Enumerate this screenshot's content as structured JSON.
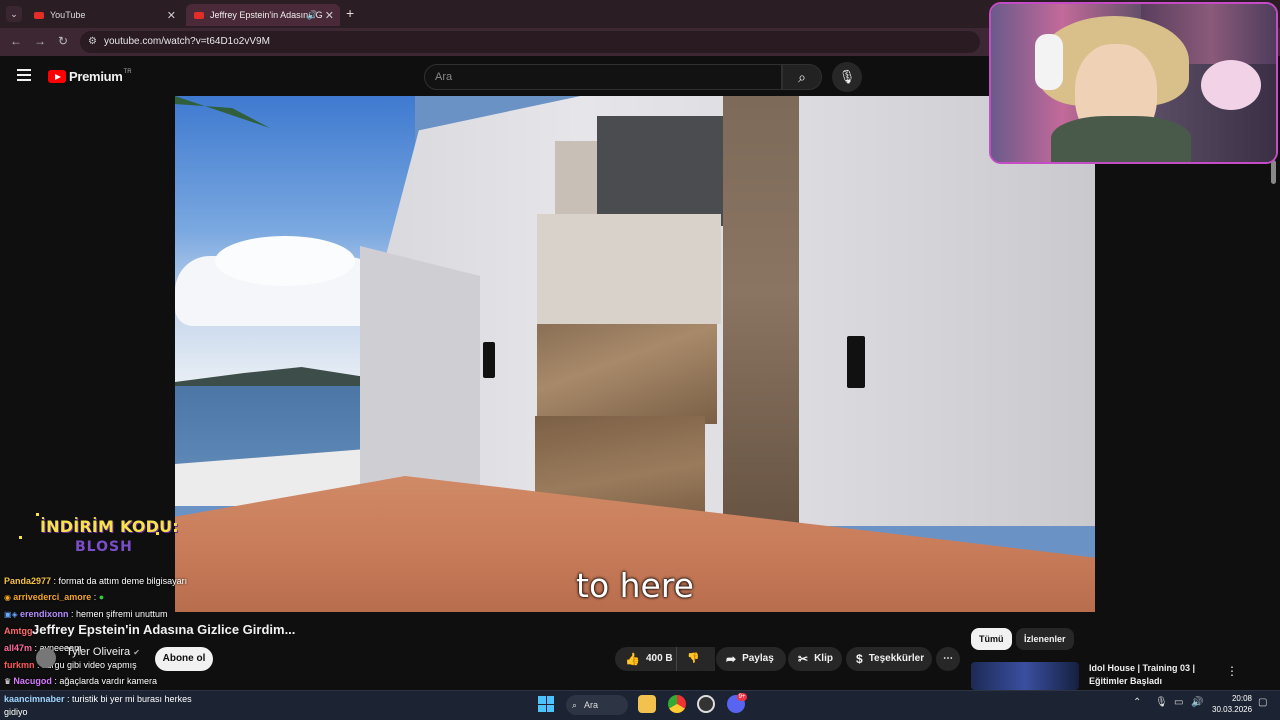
{
  "browser": {
    "tabs": [
      {
        "label": "YouTube"
      },
      {
        "label": "Jeffrey Epstein'in Adasına G"
      }
    ],
    "url": "youtube.com/watch?v=t64D1o2vV9M"
  },
  "youtube": {
    "logo_text": "Premium",
    "logo_region": "TR",
    "search_placeholder": "Ara"
  },
  "video": {
    "subtitle": "to here",
    "title": "Jeffrey Epstein'in Adasına Gizlice Girdim...",
    "channel": "Tyler Oliveira",
    "subscribe_label": "Abone ol",
    "likes": "400 B",
    "share_label": "Paylaş",
    "clip_label": "Klip",
    "thanks_label": "Teşekkürler"
  },
  "sidebar": {
    "chips": [
      "Tümü",
      "İzlenenler"
    ],
    "recommendation": {
      "title": "Idol House | Training 03 | Eğitimler Başladı"
    }
  },
  "overlay": {
    "promo_line1": "İNDİRİM KODU:",
    "promo_line2": "BLOSH",
    "chat": [
      {
        "user": "Panda2977",
        "text": " : format da attım deme bilgisayarı",
        "color": "#f7c24a"
      },
      {
        "user": "arrivederci_amore",
        "text": " : ",
        "color": "#f5a623"
      },
      {
        "user": "erendixonn",
        "text": " : hemen şifremi unuttum",
        "color": "#b48cff"
      },
      {
        "user": "Amtgg",
        "text": " : ",
        "color": "#ff6b6b"
      },
      {
        "user": "all47m",
        "text": " : ayneeeem",
        "color": "#ff6b9a"
      },
      {
        "user": "furkmn",
        "text": " : kurgu gibi video yapmış",
        "color": "#ff5a5a"
      },
      {
        "user": "Nacugod",
        "text": " : ağaçlarda vardır kamera",
        "color": "#d67bff"
      },
      {
        "user": "kaancimnaber",
        "text": " : turistik bi yer mi burası herkes gidiyo",
        "color": "#9fd4ff"
      }
    ]
  },
  "taskbar": {
    "search_label": "Ara",
    "discord_badge": "9+",
    "time": "20:08",
    "date": "30.03.2026"
  },
  "colors": {
    "youtube_red": "#ff0000",
    "webcam_border": "#c44cc4",
    "promo_yellow": "#f7e24a",
    "promo_purple": "#7b4ec9"
  }
}
